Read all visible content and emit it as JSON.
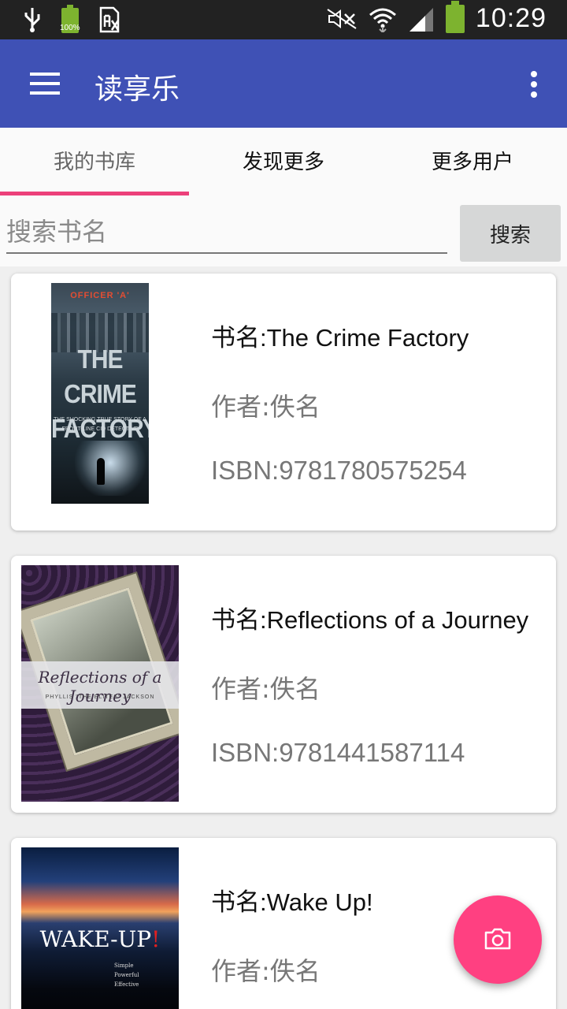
{
  "status_bar": {
    "time": "10:29",
    "battery_percent_label": "100%",
    "icons": [
      "usb-icon",
      "battery-icon",
      "sim-icon",
      "mute-icon",
      "wifi-icon",
      "signal-icon",
      "battery-icon"
    ]
  },
  "app_bar": {
    "title": "读享乐",
    "color": "#3f51b5"
  },
  "tabs": [
    {
      "label": "我的书库",
      "active": true
    },
    {
      "label": "发现更多",
      "active": false
    },
    {
      "label": "更多用户",
      "active": false
    }
  ],
  "search": {
    "placeholder": "搜索书名",
    "button_label": "搜索"
  },
  "books": [
    {
      "title": "书名:The Crime Factory",
      "author": "作者:佚名",
      "isbn": "ISBN:9781780575254",
      "cover": {
        "top_text": "OFFICER 'A'",
        "title_line1": "THE CRIME",
        "title_line2": "FACTORY",
        "subtitle": "THE SHOCKING TRUE STORY OF A FRONT-LINE CID DETECTIVE"
      }
    },
    {
      "title": "书名:Reflections of a Journey",
      "author": "作者:佚名",
      "isbn": "ISBN:9781441587114",
      "cover": {
        "title": "Reflections of a Journey",
        "subtitle": "PHYLLIS \"THE ELITES\" JACKSON"
      }
    },
    {
      "title": "书名:Wake Up!",
      "author": "作者:佚名",
      "cover": {
        "title": "WAKE-UP",
        "bang": "!",
        "subtitle_lines": [
          "Simple",
          "Powerful",
          "Effective"
        ]
      }
    }
  ],
  "fab": {
    "icon": "camera-icon",
    "color": "#ff4081"
  },
  "accent": "#ec407a"
}
